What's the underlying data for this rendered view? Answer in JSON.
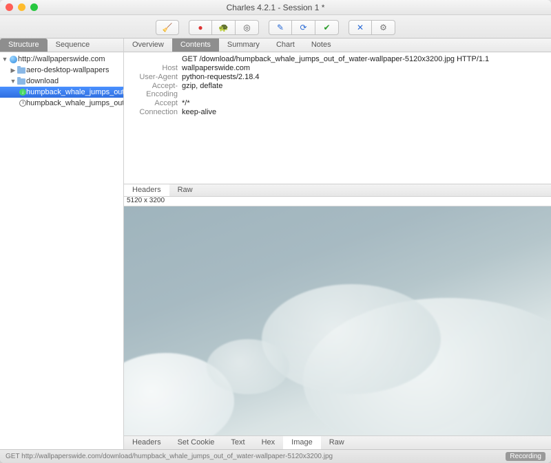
{
  "window": {
    "title": "Charles 4.2.1 - Session 1 *"
  },
  "toolbar_icons": {
    "broom": "🧹",
    "record": "●",
    "throttle": "🐢",
    "breakpoints": "◎",
    "edit": "✎",
    "repeat": "⟳",
    "validate": "✔",
    "tools": "✕",
    "settings": "⚙"
  },
  "sidebar": {
    "tabs": {
      "structure": "Structure",
      "sequence": "Sequence"
    },
    "tree": {
      "host": "http://wallpaperswide.com",
      "folder1": "aero-desktop-wallpapers",
      "folder2": "download",
      "item_selected": "humpback_whale_jumps_out_of_",
      "item_pending": "humpback_whale_jumps_out_of_wat"
    }
  },
  "main_tabs": {
    "overview": "Overview",
    "contents": "Contents",
    "summary": "Summary",
    "chart": "Chart",
    "notes": "Notes"
  },
  "request": {
    "line": "GET /download/humpback_whale_jumps_out_of_water-wallpaper-5120x3200.jpg HTTP/1.1",
    "headers": {
      "Host": "wallpaperswide.com",
      "User-Agent": "python-requests/2.18.4",
      "Accept-Encoding": "gzip, deflate",
      "Accept": "*/*",
      "Connection": "keep-alive"
    }
  },
  "req_sub_tabs": {
    "headers": "Headers",
    "raw": "Raw"
  },
  "image_dims": "5120 x 3200",
  "resp_tabs": {
    "headers": "Headers",
    "setcookie": "Set Cookie",
    "text": "Text",
    "hex": "Hex",
    "image": "Image",
    "raw": "Raw"
  },
  "status": {
    "text": "GET http://wallpaperswide.com/download/humpback_whale_jumps_out_of_water-wallpaper-5120x3200.jpg",
    "recording": "Recording"
  }
}
